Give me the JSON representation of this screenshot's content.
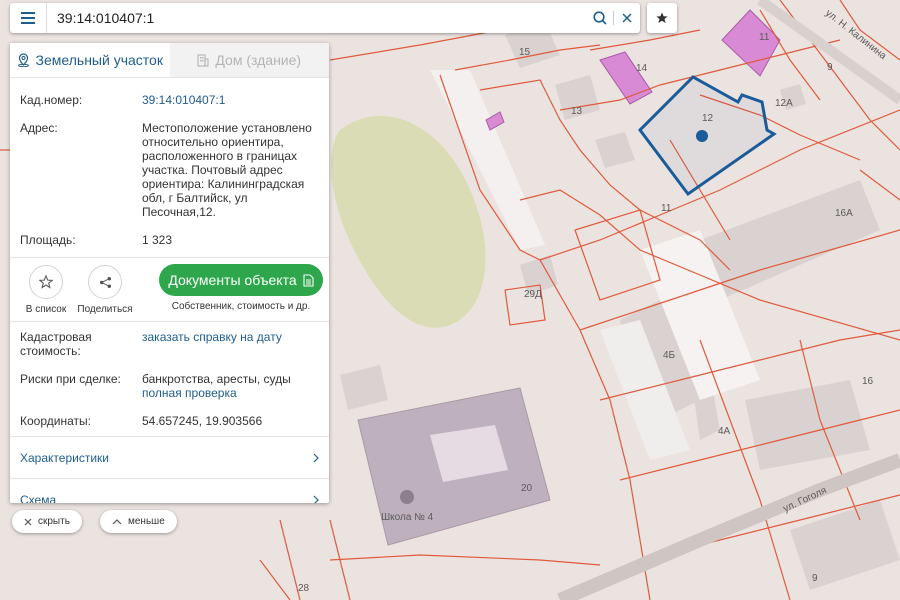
{
  "search": {
    "value": "39:14:010407:1"
  },
  "tabs": [
    {
      "label": "Земельный участок",
      "icon": "land-plot-icon",
      "active": true
    },
    {
      "label": "Дом (здание)",
      "icon": "building-icon",
      "active": false
    }
  ],
  "info": {
    "kad_label": "Кад.номер:",
    "kad_value": "39:14:010407:1",
    "address_label": "Адрес:",
    "address_value": "Местоположение установлено относительно ориентира, расположенного в границах участка. Почтовый адрес ориентира: Калининградская обл, г Балтийск, ул Песочная,12.",
    "area_label": "Площадь:",
    "area_value": "1 323"
  },
  "actions": {
    "favorite_label": "В список",
    "share_label": "Поделиться",
    "docs_label": "Документы объекта",
    "docs_sub": "Собственник, стоимость и др."
  },
  "extra": {
    "cost_label": "Кадастровая стоимость:",
    "cost_link": "заказать справку на дату",
    "risk_label": "Риски при сделке:",
    "risk_value": "банкротства, аресты, суды",
    "risk_link": "полная проверка",
    "coord_label": "Координаты:",
    "coord_value": "54.657245, 19.903566"
  },
  "accordion": {
    "characteristics": "Характеристики",
    "scheme": "Схема"
  },
  "pills": {
    "hide": "скрыть",
    "less": "меньше"
  },
  "map_labels": {
    "n15": "15",
    "n14": "14",
    "n13": "13",
    "n12": "12",
    "n12a": "12А",
    "n11a": "11",
    "n11b": "11",
    "n9a": "9",
    "n16a": "16А",
    "n16": "16",
    "n29": "29Д",
    "n4b": "4Б",
    "n4a": "4А",
    "n20": "20",
    "n28": "28",
    "n9b": "9",
    "school": "Школа № 4",
    "street1": "ул. Н. Калинина",
    "street2": "ул. Гоголя"
  },
  "colors": {
    "accent": "#1f5d8e",
    "green": "#2ea64b",
    "parcel_line": "#e05a3c",
    "selected": "#1a5b9a"
  }
}
